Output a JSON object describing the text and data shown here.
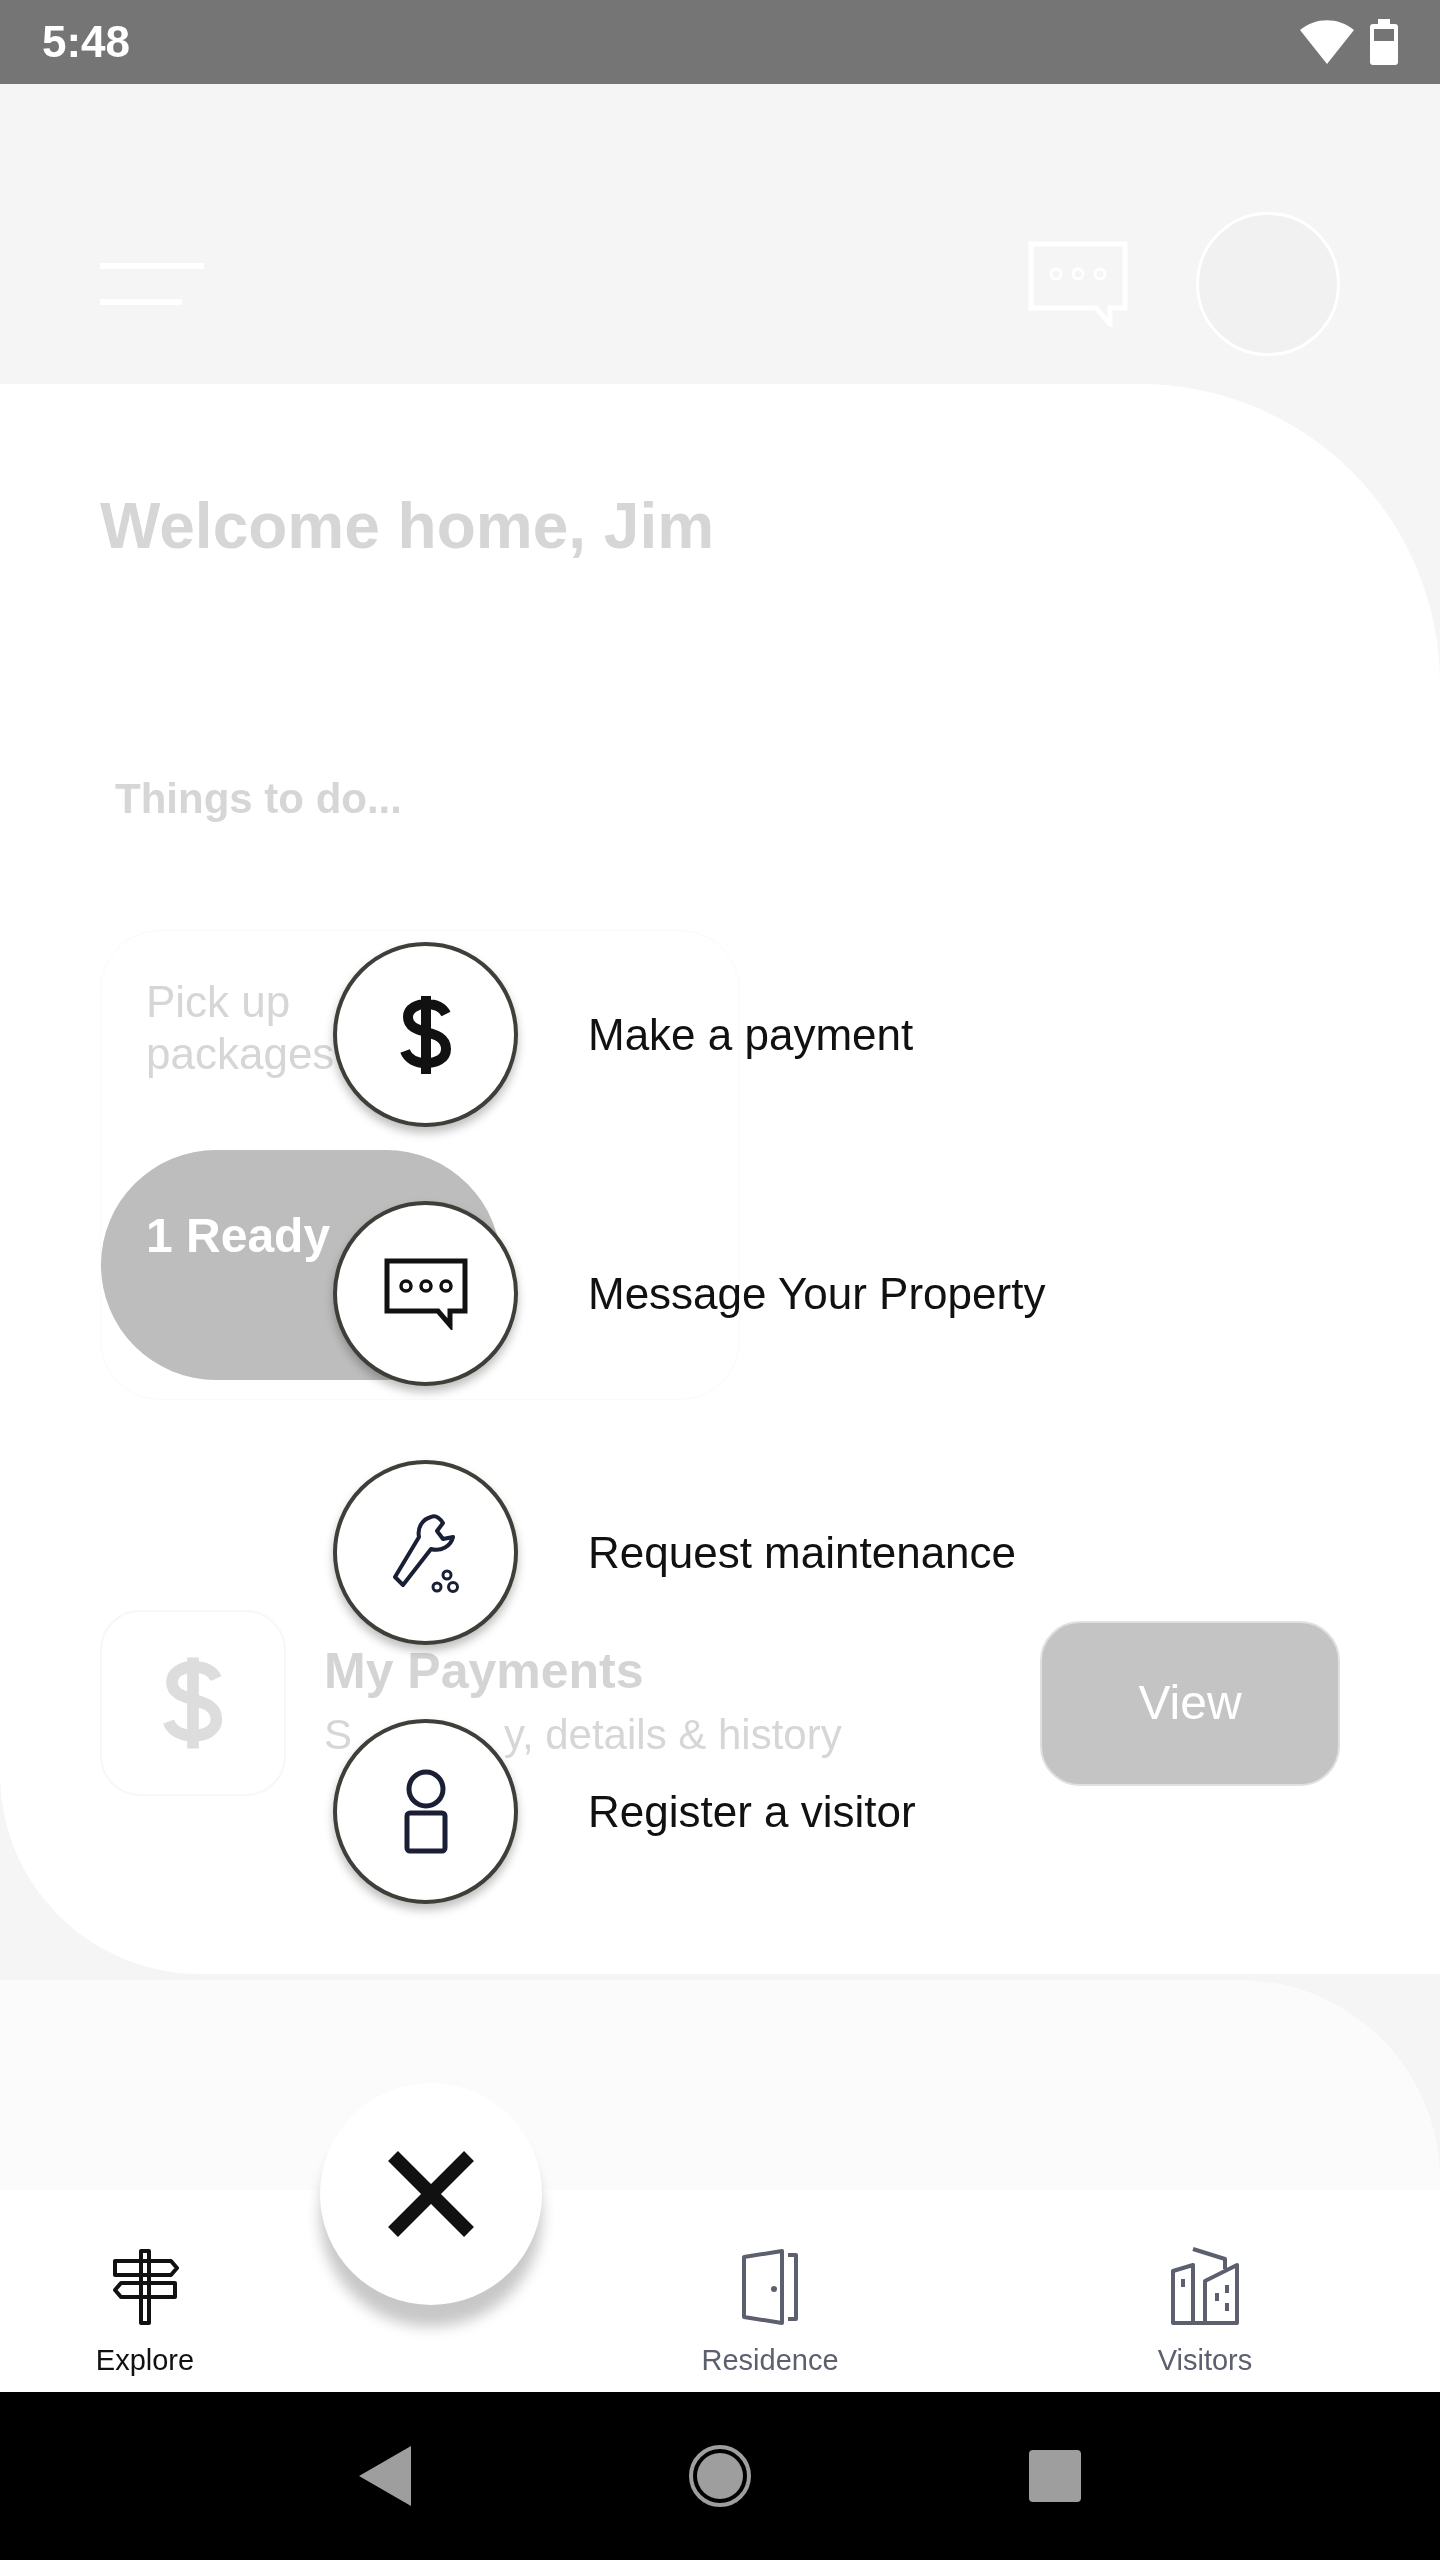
{
  "status_bar": {
    "time": "5:48"
  },
  "background": {
    "title": "Welcome home, Jim",
    "section": "Things to do...",
    "task": {
      "title": "Pick up packages",
      "badge": "1 Ready"
    },
    "payments": {
      "title": "My Payments",
      "subtitle_start": "S",
      "subtitle_end": "y, details & history",
      "button": "View"
    }
  },
  "actions": [
    {
      "label": "Make a payment"
    },
    {
      "label": "Message Your Property"
    },
    {
      "label": "Request maintenance"
    },
    {
      "label": "Register a visitor"
    }
  ],
  "nav": [
    {
      "label": "Explore",
      "selected": true
    },
    {
      "label": "Residence",
      "selected": false
    },
    {
      "label": "Visitors",
      "selected": false
    }
  ]
}
